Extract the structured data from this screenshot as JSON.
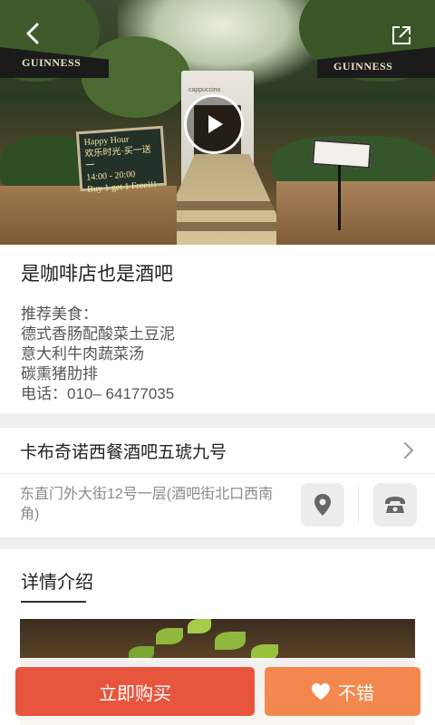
{
  "hero": {
    "umbrella_left_text": "GUINNESS",
    "umbrella_right_text": "GUINNESS",
    "building_sign": "cappuccino",
    "board_lines": [
      "Happy Hour",
      "欢乐时光·买一送一",
      "14:00 - 20:00",
      "Buy 1 get 1 Free!!!"
    ]
  },
  "info": {
    "title": "是咖啡店也是酒吧",
    "recommend_label": "推荐美食：",
    "dishes": [
      "德式香肠配酸菜土豆泥",
      "意大利牛肉蔬菜汤",
      "碳熏猪肋排"
    ],
    "phone_line": "电话：010– 64177035"
  },
  "shop": {
    "name": "卡布奇诺西餐酒吧五琥九号",
    "address": "东直门外大街12号一层(酒吧街北口西南角)"
  },
  "detail": {
    "heading": "详情介绍"
  },
  "actions": {
    "buy_label": "立即购买",
    "like_label": "不错"
  },
  "colors": {
    "buy": "#e8553f",
    "like": "#f3884f",
    "section_gap": "#efefef"
  },
  "icons": {
    "back": "chevron-left-icon",
    "share": "share-icon",
    "play": "play-icon",
    "arrow": "chevron-right-icon",
    "location": "location-pin-icon",
    "phone": "phone-icon",
    "heart": "heart-icon"
  }
}
